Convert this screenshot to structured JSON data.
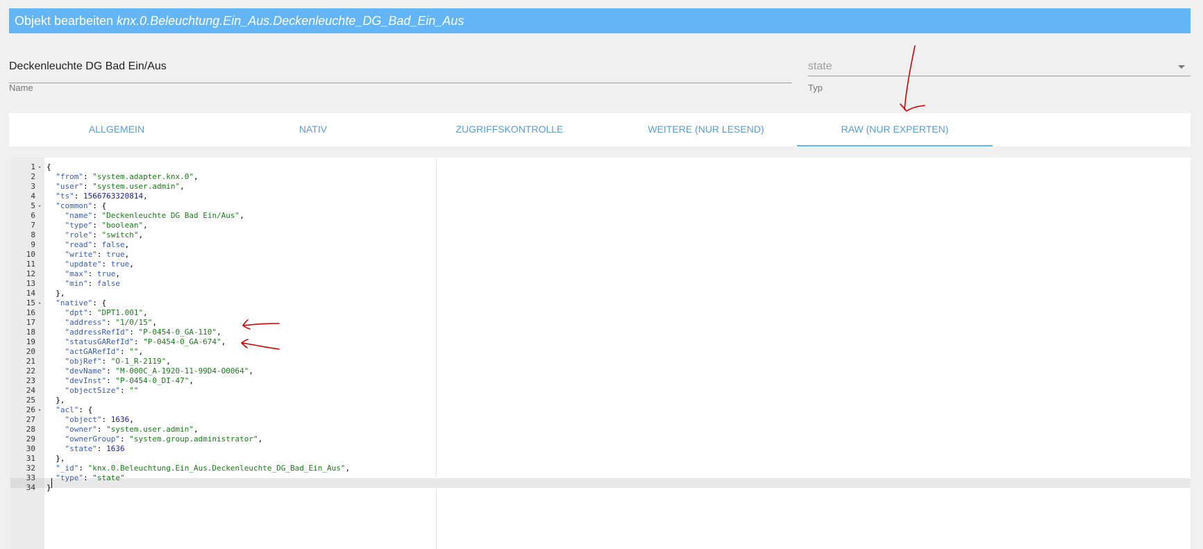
{
  "dialog": {
    "title_prefix": "Objekt bearbeiten",
    "object_id": "knx.0.Beleuchtung.Ein_Aus.Deckenleuchte_DG_Bad_Ein_Aus"
  },
  "form": {
    "name_value": "Deckenleuchte DG Bad Ein/Aus",
    "name_label": "Name",
    "type_value": "state",
    "type_label": "Typ"
  },
  "tabs": [
    {
      "label": "ALLGEMEIN"
    },
    {
      "label": "NATIV"
    },
    {
      "label": "ZUGRIFFSKONTROLLE"
    },
    {
      "label": "WEITERE (NUR LESEND)"
    },
    {
      "label": "RAW (NUR EXPERTEN)",
      "active": true
    }
  ],
  "editor": {
    "active_line": 34,
    "lines": [
      [
        [
          "p",
          "{"
        ]
      ],
      [
        [
          "p",
          "  "
        ],
        [
          "k",
          "\"from\""
        ],
        [
          "p",
          ": "
        ],
        [
          "s",
          "\"system.adapter.knx.0\""
        ],
        [
          "p",
          ","
        ]
      ],
      [
        [
          "p",
          "  "
        ],
        [
          "k",
          "\"user\""
        ],
        [
          "p",
          ": "
        ],
        [
          "s",
          "\"system.user.admin\""
        ],
        [
          "p",
          ","
        ]
      ],
      [
        [
          "p",
          "  "
        ],
        [
          "k",
          "\"ts\""
        ],
        [
          "p",
          ": "
        ],
        [
          "n",
          "1566763320814"
        ],
        [
          "p",
          ","
        ]
      ],
      [
        [
          "p",
          "  "
        ],
        [
          "k",
          "\"common\""
        ],
        [
          "p",
          ": {"
        ]
      ],
      [
        [
          "p",
          "    "
        ],
        [
          "k",
          "\"name\""
        ],
        [
          "p",
          ": "
        ],
        [
          "s",
          "\"Deckenleuchte DG Bad Ein/Aus\""
        ],
        [
          "p",
          ","
        ]
      ],
      [
        [
          "p",
          "    "
        ],
        [
          "k",
          "\"type\""
        ],
        [
          "p",
          ": "
        ],
        [
          "s",
          "\"boolean\""
        ],
        [
          "p",
          ","
        ]
      ],
      [
        [
          "p",
          "    "
        ],
        [
          "k",
          "\"role\""
        ],
        [
          "p",
          ": "
        ],
        [
          "s",
          "\"switch\""
        ],
        [
          "p",
          ","
        ]
      ],
      [
        [
          "p",
          "    "
        ],
        [
          "k",
          "\"read\""
        ],
        [
          "p",
          ": "
        ],
        [
          "b",
          "false"
        ],
        [
          "p",
          ","
        ]
      ],
      [
        [
          "p",
          "    "
        ],
        [
          "k",
          "\"write\""
        ],
        [
          "p",
          ": "
        ],
        [
          "b",
          "true"
        ],
        [
          "p",
          ","
        ]
      ],
      [
        [
          "p",
          "    "
        ],
        [
          "k",
          "\"update\""
        ],
        [
          "p",
          ": "
        ],
        [
          "b",
          "true"
        ],
        [
          "p",
          ","
        ]
      ],
      [
        [
          "p",
          "    "
        ],
        [
          "k",
          "\"max\""
        ],
        [
          "p",
          ": "
        ],
        [
          "b",
          "true"
        ],
        [
          "p",
          ","
        ]
      ],
      [
        [
          "p",
          "    "
        ],
        [
          "k",
          "\"min\""
        ],
        [
          "p",
          ": "
        ],
        [
          "b",
          "false"
        ]
      ],
      [
        [
          "p",
          "  },"
        ]
      ],
      [
        [
          "p",
          "  "
        ],
        [
          "k",
          "\"native\""
        ],
        [
          "p",
          ": {"
        ]
      ],
      [
        [
          "p",
          "    "
        ],
        [
          "k",
          "\"dpt\""
        ],
        [
          "p",
          ": "
        ],
        [
          "s",
          "\"DPT1.001\""
        ],
        [
          "p",
          ","
        ]
      ],
      [
        [
          "p",
          "    "
        ],
        [
          "k",
          "\"address\""
        ],
        [
          "p",
          ": "
        ],
        [
          "s",
          "\"1/0/15\""
        ],
        [
          "p",
          ","
        ]
      ],
      [
        [
          "p",
          "    "
        ],
        [
          "k",
          "\"addressRefId\""
        ],
        [
          "p",
          ": "
        ],
        [
          "s",
          "\"P-0454-0_GA-110\""
        ],
        [
          "p",
          ","
        ]
      ],
      [
        [
          "p",
          "    "
        ],
        [
          "k",
          "\"statusGARefId\""
        ],
        [
          "p",
          ": "
        ],
        [
          "s",
          "\"P-0454-0_GA-674\""
        ],
        [
          "p",
          ","
        ]
      ],
      [
        [
          "p",
          "    "
        ],
        [
          "k",
          "\"actGARefId\""
        ],
        [
          "p",
          ": "
        ],
        [
          "s",
          "\"\""
        ],
        [
          "p",
          ","
        ]
      ],
      [
        [
          "p",
          "    "
        ],
        [
          "k",
          "\"objRef\""
        ],
        [
          "p",
          ": "
        ],
        [
          "s",
          "\"O-1_R-2119\""
        ],
        [
          "p",
          ","
        ]
      ],
      [
        [
          "p",
          "    "
        ],
        [
          "k",
          "\"devName\""
        ],
        [
          "p",
          ": "
        ],
        [
          "s",
          "\"M-000C_A-1920-11-99D4-O0064\""
        ],
        [
          "p",
          ","
        ]
      ],
      [
        [
          "p",
          "    "
        ],
        [
          "k",
          "\"devInst\""
        ],
        [
          "p",
          ": "
        ],
        [
          "s",
          "\"P-0454-0_DI-47\""
        ],
        [
          "p",
          ","
        ]
      ],
      [
        [
          "p",
          "    "
        ],
        [
          "k",
          "\"objectSize\""
        ],
        [
          "p",
          ": "
        ],
        [
          "s",
          "\"\""
        ]
      ],
      [
        [
          "p",
          "  },"
        ]
      ],
      [
        [
          "p",
          "  "
        ],
        [
          "k",
          "\"acl\""
        ],
        [
          "p",
          ": {"
        ]
      ],
      [
        [
          "p",
          "    "
        ],
        [
          "k",
          "\"object\""
        ],
        [
          "p",
          ": "
        ],
        [
          "n",
          "1636"
        ],
        [
          "p",
          ","
        ]
      ],
      [
        [
          "p",
          "    "
        ],
        [
          "k",
          "\"owner\""
        ],
        [
          "p",
          ": "
        ],
        [
          "s",
          "\"system.user.admin\""
        ],
        [
          "p",
          ","
        ]
      ],
      [
        [
          "p",
          "    "
        ],
        [
          "k",
          "\"ownerGroup\""
        ],
        [
          "p",
          ": "
        ],
        [
          "s",
          "\"system.group.administrator\""
        ],
        [
          "p",
          ","
        ]
      ],
      [
        [
          "p",
          "    "
        ],
        [
          "k",
          "\"state\""
        ],
        [
          "p",
          ": "
        ],
        [
          "n",
          "1636"
        ]
      ],
      [
        [
          "p",
          "  },"
        ]
      ],
      [
        [
          "p",
          "  "
        ],
        [
          "k",
          "\"_id\""
        ],
        [
          "p",
          ": "
        ],
        [
          "s",
          "\"knx.0.Beleuchtung.Ein_Aus.Deckenleuchte_DG_Bad_Ein_Aus\""
        ],
        [
          "p",
          ","
        ]
      ],
      [
        [
          "p",
          "  "
        ],
        [
          "k",
          "\"type\""
        ],
        [
          "p",
          ": "
        ],
        [
          "s",
          "\"state\""
        ]
      ],
      [
        [
          "p",
          "}"
        ]
      ]
    ],
    "fold_lines": [
      1,
      5,
      15,
      26
    ]
  },
  "colors": {
    "title_bar": "#64b5f6",
    "tab_text": "#5b9bd5",
    "annotation_ink": "#d40000"
  },
  "icons": {
    "dropdown": "caret-down-icon",
    "fold": "fold-arrow-icon"
  }
}
